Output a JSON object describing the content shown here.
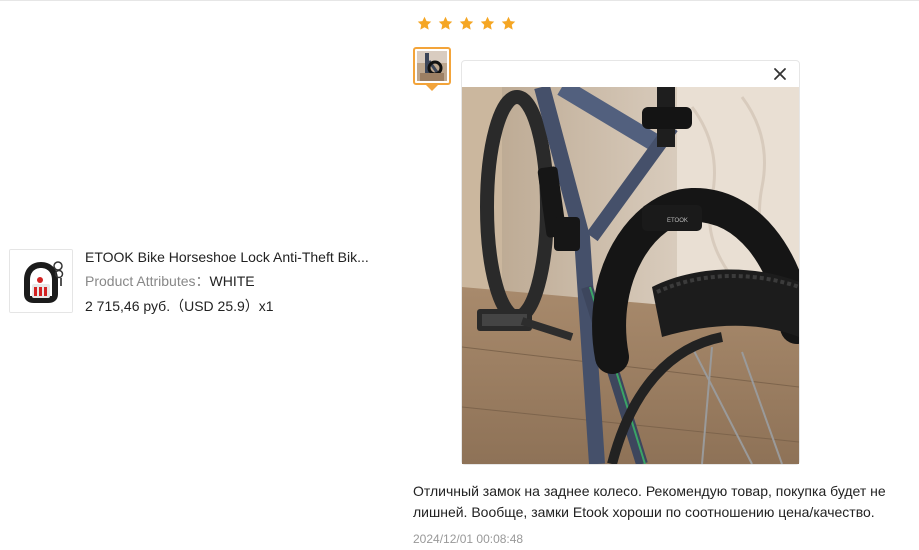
{
  "product": {
    "title": "ETOOK Bike Horseshoe Lock Anti-Theft Bik...",
    "attributes_label": "Product Attributes：",
    "attributes_value": "WHITE",
    "price": "2 715,46 руб.（USD  25.9）x1",
    "thumbnail_icon": "horseshoe-lock-image"
  },
  "review": {
    "rating": 5,
    "rating_max": 5,
    "star_color": "#f5a623",
    "thumbnail_border_color": "#f3a43a",
    "viewer_close_icon": "close-icon",
    "photo_subject": "bike-horseshoe-lock-photo",
    "text": "Отличный замок на заднее колесо. Рекомендую товар, покупка будет не лишней. Вообще, замки Etook хороши по соотношению цена/качество.",
    "date": "2024/12/01 00:08:48"
  }
}
